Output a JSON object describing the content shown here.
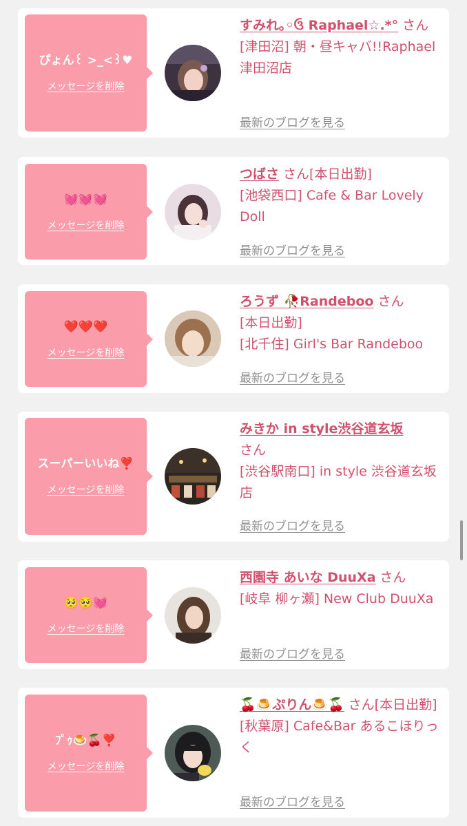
{
  "common": {
    "delete_label": "メッセージを削除",
    "blog_label": "最新のブログを見る",
    "san": "さん"
  },
  "colors": {
    "bubble": "#fa9caa",
    "accent_text": "#d1506d",
    "muted_text": "#8f8f8f",
    "background": "#f1f1f1"
  },
  "items": [
    {
      "message": "ぴょん꒰ >_<꒱♥",
      "name": "すみれ｡◦ઉ Raphael☆.*°",
      "suffix": "",
      "shop": "[津田沼] 朝・昼キャバ!!Raphael 津田沼店"
    },
    {
      "message": "💓💓💓",
      "name": "つばさ",
      "suffix": "[本日出勤]",
      "shop": "[池袋西口] Cafe & Bar Lovely Doll"
    },
    {
      "message": "❤️❤️❤️",
      "name": "ろうず 🥀Randeboo",
      "suffix": "[本日出勤]",
      "shop": "[北千住] Girl's Bar Randeboo"
    },
    {
      "message": "スーパーいいね❣️",
      "name": "みきか in style渋谷道玄坂",
      "suffix": "",
      "shop": "[渋谷駅南口] in style 渋谷道玄坂店"
    },
    {
      "message": "🥺🥺💓",
      "name": "西園寺 あいな DuuXa",
      "suffix": "",
      "shop": "[岐阜 柳ヶ瀬] New Club DuuXa"
    },
    {
      "message": "ﾌﾟｩ🍮🍒❣️",
      "name": "🍒🍮ぷりん🍮🍒",
      "suffix": "[本日出勤]",
      "shop": "[秋葉原] Cafe&Bar あるこほりっく"
    }
  ]
}
